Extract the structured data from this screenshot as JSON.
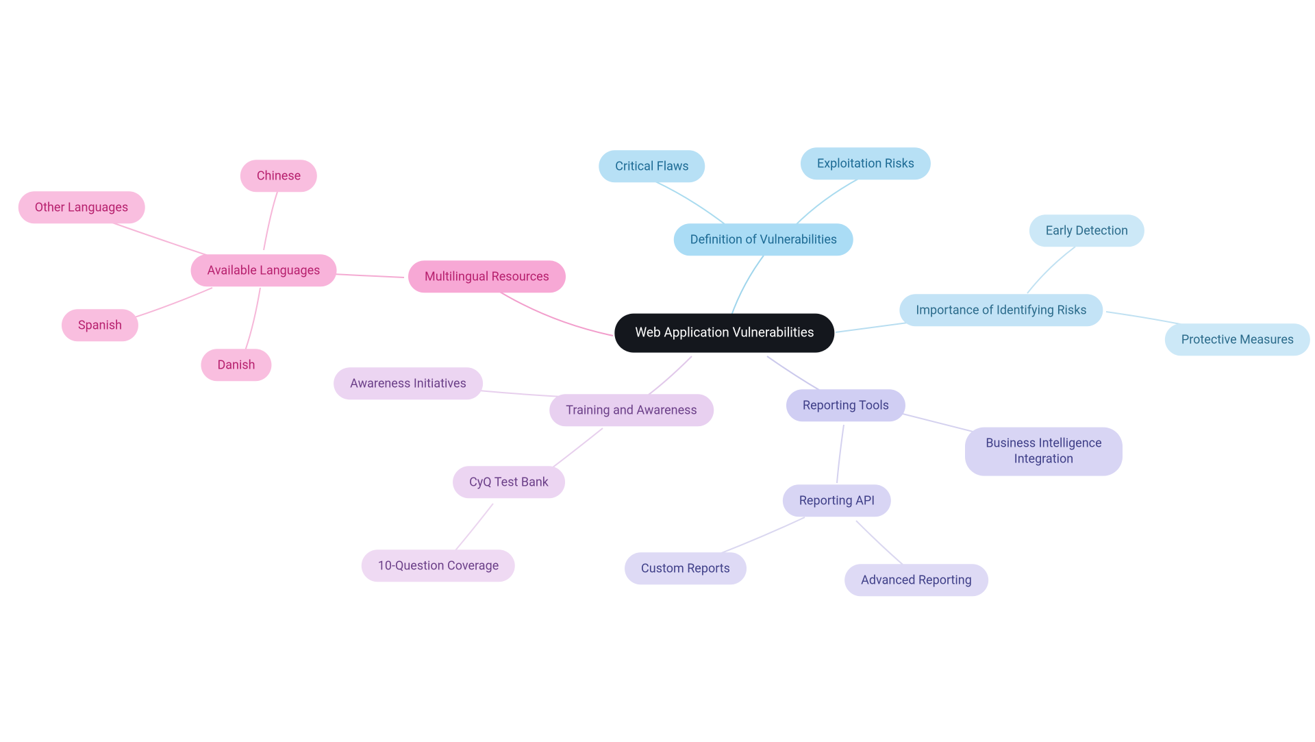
{
  "nodes": {
    "root": "Web Application Vulnerabilities",
    "definition": "Definition of Vulnerabilities",
    "critical_flaws": "Critical Flaws",
    "exploitation_risks": "Exploitation Risks",
    "importance": "Importance of Identifying Risks",
    "early_detection": "Early Detection",
    "protective": "Protective Measures",
    "reporting_tools": "Reporting Tools",
    "bi_integration": "Business Intelligence Integration",
    "reporting_api": "Reporting API",
    "custom_reports": "Custom Reports",
    "advanced_reporting": "Advanced Reporting",
    "training": "Training and Awareness",
    "awareness_init": "Awareness Initiatives",
    "cyq": "CyQ Test Bank",
    "ten_q": "10-Question Coverage",
    "multilingual": "Multilingual Resources",
    "available_langs": "Available Languages",
    "chinese": "Chinese",
    "other_langs": "Other Languages",
    "spanish": "Spanish",
    "danish": "Danish"
  }
}
